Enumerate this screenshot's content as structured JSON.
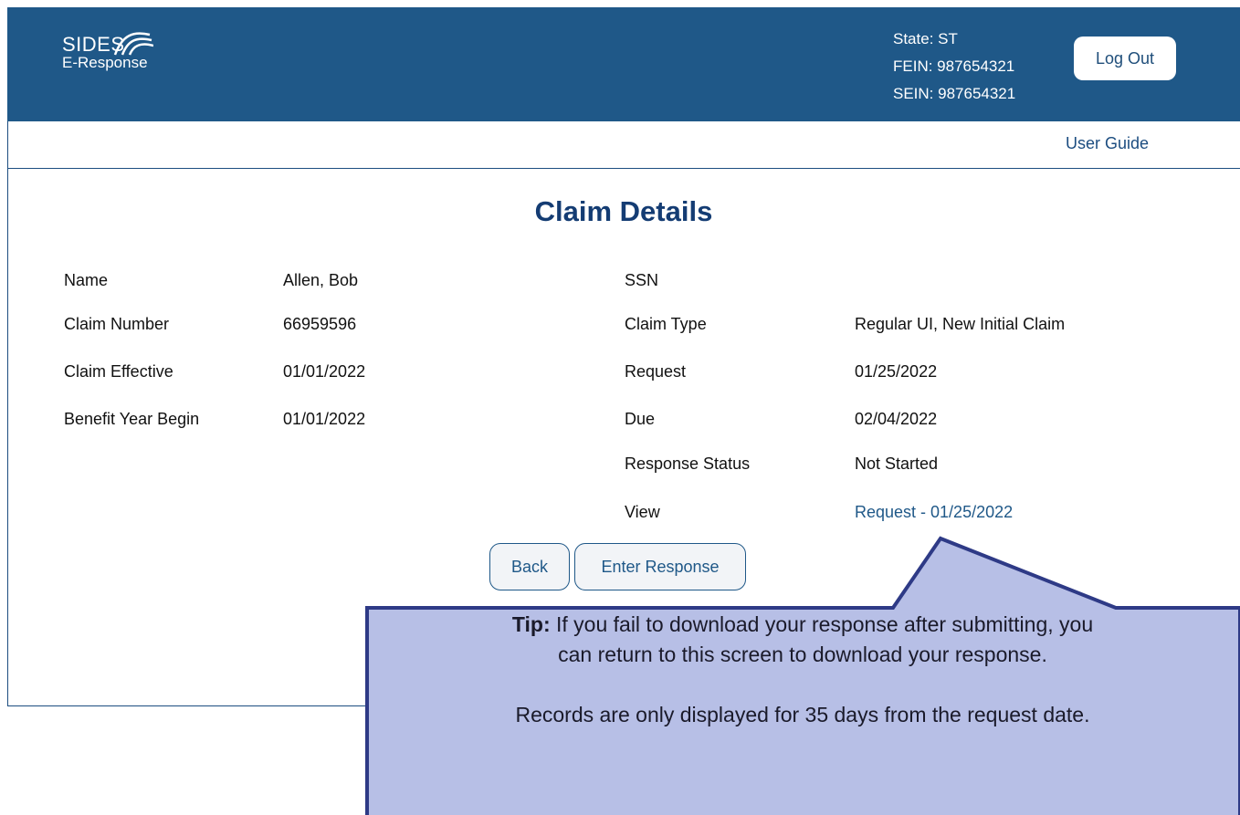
{
  "header": {
    "logo_main": "SIDES",
    "logo_sub": "E-Response",
    "state": "State: ST",
    "fein": "FEIN: 987654321",
    "sein": "SEIN: 987654321",
    "logout_label": "Log Out"
  },
  "nav": {
    "user_guide": "User Guide"
  },
  "page": {
    "title": "Claim Details"
  },
  "details_left": [
    {
      "label": "Name",
      "value": "Allen, Bob"
    },
    {
      "label": "Claim Number",
      "value": "66959596"
    },
    {
      "label": "Claim Effective",
      "value": "01/01/2022"
    },
    {
      "label": "Benefit Year Begin",
      "value": "01/01/2022"
    }
  ],
  "details_right": [
    {
      "label": "SSN",
      "value": ""
    },
    {
      "label": "Claim Type",
      "value": "Regular UI, New Initial Claim"
    },
    {
      "label": "Request",
      "value": "01/25/2022"
    },
    {
      "label": "Due",
      "value": "02/04/2022"
    },
    {
      "label": "Response Status",
      "value": "Not Started"
    },
    {
      "label": "View",
      "value": "Request - 01/25/2022"
    }
  ],
  "actions": {
    "back": "Back",
    "enter_response": "Enter Response"
  },
  "tip": {
    "prefix": "Tip:",
    "line1": "If you fail to download your response after submitting, you",
    "line2": "can return to this screen to download your response.",
    "line3": "Records are only displayed for 35 days from the request date."
  },
  "colors": {
    "header_bg": "#1f5888",
    "title": "#143c73",
    "tip_bg": "#b7bfe6",
    "tip_border": "#2e3a86"
  }
}
